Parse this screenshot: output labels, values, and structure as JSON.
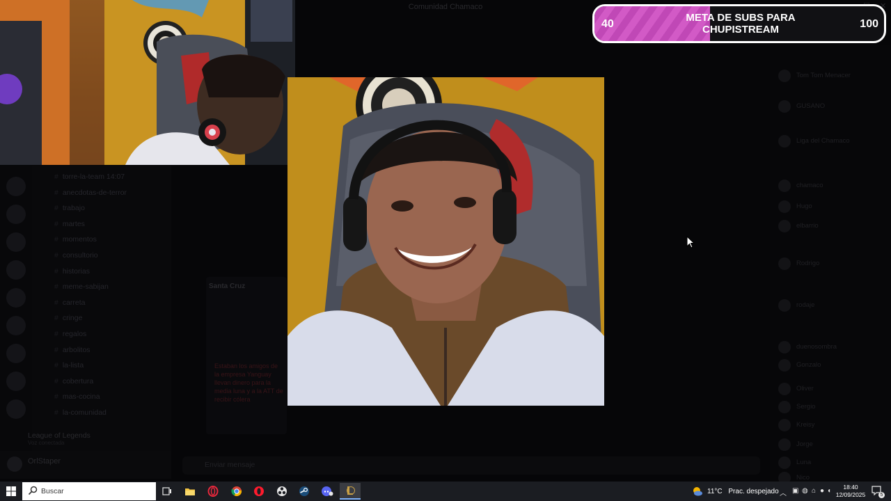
{
  "background_app": {
    "title": "Comunidad Chamaco",
    "channels": [
      "torre-la-team 14:07",
      "anecdotas-de-terror",
      "trabajo",
      "martes",
      "momentos",
      "consultorio",
      "historias",
      "meme-sabijan",
      "carreta",
      "cringe",
      "regalos",
      "arbolitos",
      "la-lista",
      "cobertura",
      "mas-cocina",
      "la-comunidad"
    ],
    "voice_channel": "League of Legends",
    "voice_status": "Voz conectada",
    "user_name": "OrlStaper",
    "chat_placeholder": "Enviar mensaje",
    "card_title": "Santa Cruz",
    "card_text": "Estaban los amigos de la empresa Yanguay llevan dinero para la media luna y a la ATT de recibir cólera",
    "members": [
      "Tom Tom Menacer",
      "GUSANO",
      "Liga del Chamaco",
      "chamaco",
      "Hugo",
      "elbarrio",
      "Rodrigo",
      "rodaje",
      "duenosombra",
      "Gonzalo",
      "Oliver",
      "Sergio",
      "Kreisy",
      "Jorge",
      "Luna",
      "Nico"
    ]
  },
  "goal": {
    "current": "40",
    "target": "100",
    "title": "META DE SUBS PARA CHUPISTREAM",
    "progress_fraction": 0.4,
    "fill_color": "#d25ac6",
    "border_color": "#ffffff"
  },
  "taskbar": {
    "search_placeholder": "Buscar",
    "weather_temp": "11°C",
    "weather_text": "Prac. despejado",
    "time": "18:40",
    "date": "12/09/2025",
    "notification_count": "5",
    "apps": [
      "task-view-icon",
      "file-explorer-icon",
      "opera-gx-icon",
      "chrome-icon",
      "opera-icon",
      "obs-icon",
      "steam-icon",
      "discord-icon",
      "league-of-legends-icon"
    ]
  }
}
